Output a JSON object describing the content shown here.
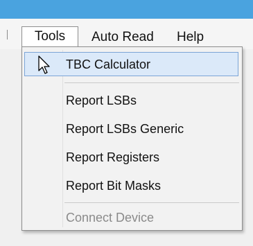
{
  "menubar": {
    "items": [
      "Tools",
      "Auto Read",
      "Help"
    ]
  },
  "tools_menu": {
    "items": [
      {
        "label": "TBC Calculator",
        "highlighted": true
      },
      {
        "label": "Report LSBs"
      },
      {
        "label": "Report LSBs Generic"
      },
      {
        "label": "Report Registers"
      },
      {
        "label": "Report Bit Masks"
      },
      {
        "label": "Connect Device",
        "disabled": true
      }
    ]
  },
  "colors": {
    "titlebar": "#4aa3df",
    "highlight_bg": "#dbe9f9",
    "highlight_border": "#7ba4d6",
    "disabled_text": "#8a8a8a"
  },
  "icons": {
    "cursor": "arrow-cursor-icon"
  }
}
